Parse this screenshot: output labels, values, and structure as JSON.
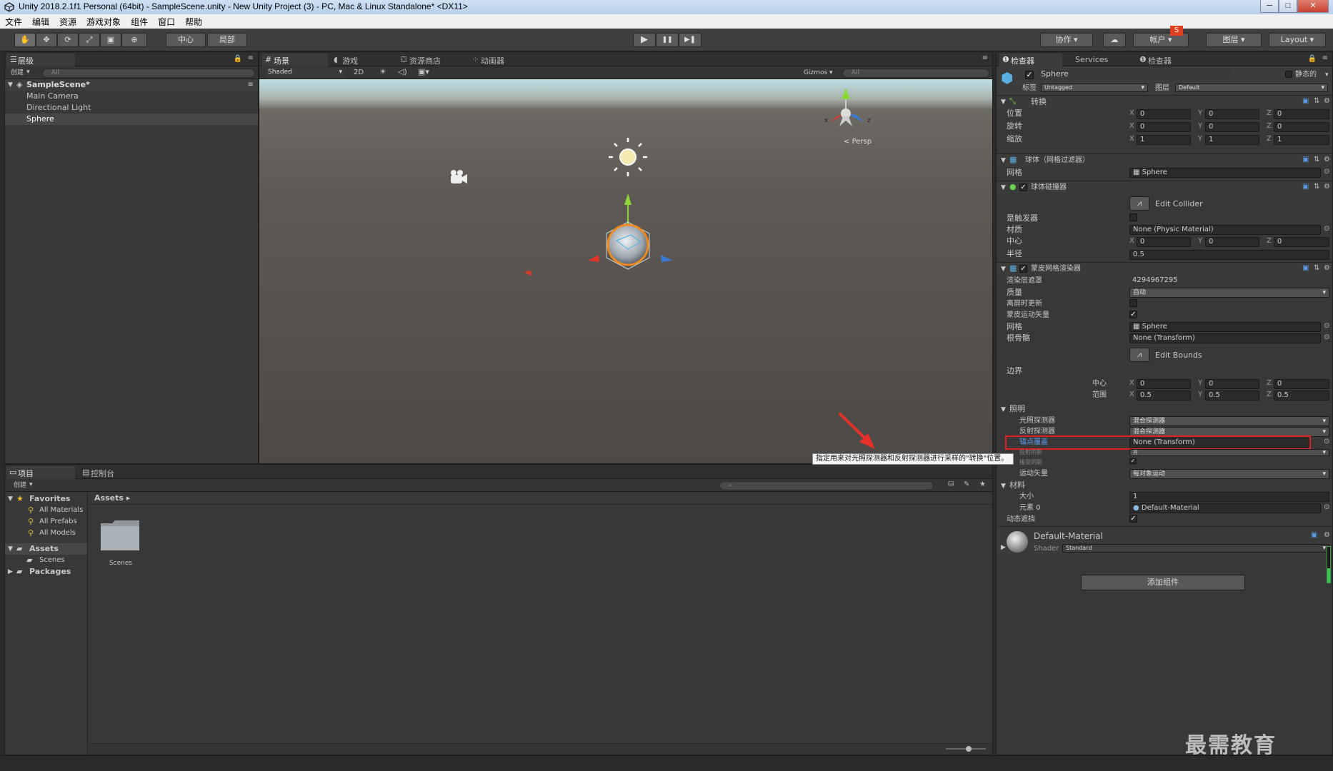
{
  "window": {
    "title": "Unity 2018.2.1f1 Personal (64bit) - SampleScene.unity - New Unity Project (3) - PC, Mac & Linux Standalone* <DX11>",
    "min": "─",
    "max": "□",
    "close": "✕"
  },
  "menu": [
    "文件",
    "编辑",
    "资源",
    "游戏对象",
    "组件",
    "窗口",
    "帮助"
  ],
  "toolbar": {
    "pivot": "中心",
    "local": "局部",
    "play": "▶",
    "pause": "❚❚",
    "step": "▶❚",
    "collab": "协作",
    "account": "帐户",
    "layers": "图层",
    "layout": "Layout"
  },
  "hierarchy": {
    "tab": "层级",
    "create": "创建",
    "search": "All",
    "scene": "SampleScene*",
    "items": [
      "Main Camera",
      "Directional Light",
      "Sphere"
    ]
  },
  "scene": {
    "tabs": [
      "场景",
      "游戏",
      "资源商店",
      "动画器"
    ],
    "shading": "Shaded",
    "mode2d": "2D",
    "gizmos": "Gizmos",
    "search": "All",
    "persp": "Persp",
    "axis_x": "x",
    "axis_z": "z"
  },
  "project": {
    "tab": "项目",
    "console_tab": "控制台",
    "create": "创建",
    "favorites": "Favorites",
    "fav_items": [
      "All Materials",
      "All Prefabs",
      "All Models"
    ],
    "assets": "Assets",
    "scenes": "Scenes",
    "packages": "Packages",
    "breadcrumb": "Assets",
    "folder": "Scenes"
  },
  "inspector": {
    "tabs": [
      "检查器",
      "Services",
      "检查器"
    ],
    "object_name": "Sphere",
    "static_label": "静态的",
    "tag_label": "标签",
    "tag": "Untagged",
    "layer_label": "图层",
    "layer": "Default",
    "transform": {
      "title": "转换",
      "rows": [
        {
          "label": "位置",
          "x": "0",
          "y": "0",
          "z": "0"
        },
        {
          "label": "旋转",
          "x": "0",
          "y": "0",
          "z": "0"
        },
        {
          "label": "缩放",
          "x": "1",
          "y": "1",
          "z": "1"
        }
      ]
    },
    "axis": {
      "x": "X",
      "y": "Y",
      "z": "Z"
    },
    "mesh_filter": {
      "title": "球体（网格过滤器）",
      "mesh_label": "网格",
      "mesh": "Sphere"
    },
    "collider": {
      "title": "球体碰撞器",
      "edit": "Edit Collider",
      "trigger_label": "是触发器",
      "material_label": "材质",
      "material": "None (Physic Material)",
      "center_label": "中心",
      "cx": "0",
      "cy": "0",
      "cz": "0",
      "radius_label": "半径",
      "radius": "0.5"
    },
    "skinned": {
      "title": "蒙皮网格渲染器",
      "layer_mask_label": "渲染层遮罩",
      "layer_mask": "4294967295",
      "quality_label": "质量",
      "quality": "自动",
      "offscreen_label": "离屏时更新",
      "skinned_motion_label": "蒙皮运动矢量",
      "mesh_label": "网格",
      "mesh": "Sphere",
      "root_bone_label": "根骨骼",
      "root_bone": "None (Transform)",
      "edit_bounds": "Edit Bounds",
      "bounds_label": "边界",
      "bcenter_label": "中心",
      "bcx": "0",
      "bcy": "0",
      "bcz": "0",
      "bextent_label": "范围",
      "bex": "0.5",
      "bey": "0.5",
      "bez": "0.5"
    },
    "lighting": {
      "title": "照明",
      "light_probes_label": "光照探测器",
      "light_probes": "混合探测器",
      "reflection_label": "反射探测器",
      "reflection": "混合探测器",
      "anchor_label": "锚点覆盖",
      "anchor": "None (Transform)",
      "cast_shadows_label": "投射阴影",
      "cast_shadows": "开",
      "receive_label": "接受阴影",
      "motion_label": "运动矢量",
      "motion": "每对象运动"
    },
    "tooltip": "指定用来对光照探测器和反射探测器进行采样的\"转换\"位置。",
    "materials": {
      "title": "材料",
      "size_label": "大小",
      "size": "1",
      "element_label": "元素 0",
      "element": "Default-Material",
      "dynamic_label": "动态遮挡"
    },
    "material_block": {
      "name": "Default-Material",
      "shader_label": "Shader",
      "shader": "Standard"
    },
    "add_component": "添加组件"
  },
  "watermark": "最需教育",
  "colors": {
    "highlight": "#e02020",
    "blue_label": "#5b9bf0",
    "arrow": "#e8302a"
  }
}
